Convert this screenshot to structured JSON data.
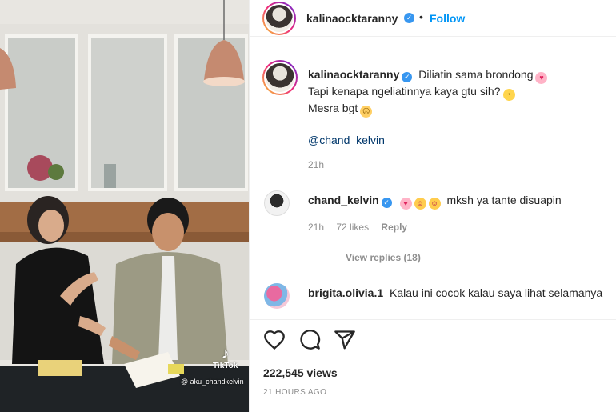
{
  "post": {
    "username": "kalinaocktaranny",
    "dot": "•",
    "follow_label": "Follow",
    "caption": {
      "line1": "Diliatin sama brondong",
      "line2": "Tapi kenapa ngeliatinnya kaya gtu sih?",
      "line3": "Mesra bgt",
      "mention": "@chand_kelvin"
    },
    "time": "21h"
  },
  "comments": [
    {
      "username": "chand_kelvin",
      "text": "mksh ya tante disuapin",
      "time": "21h",
      "likes": "72 likes",
      "reply_label": "Reply",
      "view_replies": "View replies (18)"
    },
    {
      "username": "brigita.olivia.1",
      "text": "Kalau ini cocok kalau saya lihat selamanya"
    }
  ],
  "actions": {
    "views": "222,545 views",
    "posted": "21 HOURS AGO",
    "icons": [
      "heart-icon",
      "comment-icon",
      "share-icon"
    ]
  },
  "media": {
    "watermark_brand": "TikTok",
    "watermark_user": "@ aku_chandkelvin"
  },
  "colors": {
    "link": "#0095f6",
    "verified": "#3897f0",
    "secondary_text": "#8e8e8e"
  }
}
